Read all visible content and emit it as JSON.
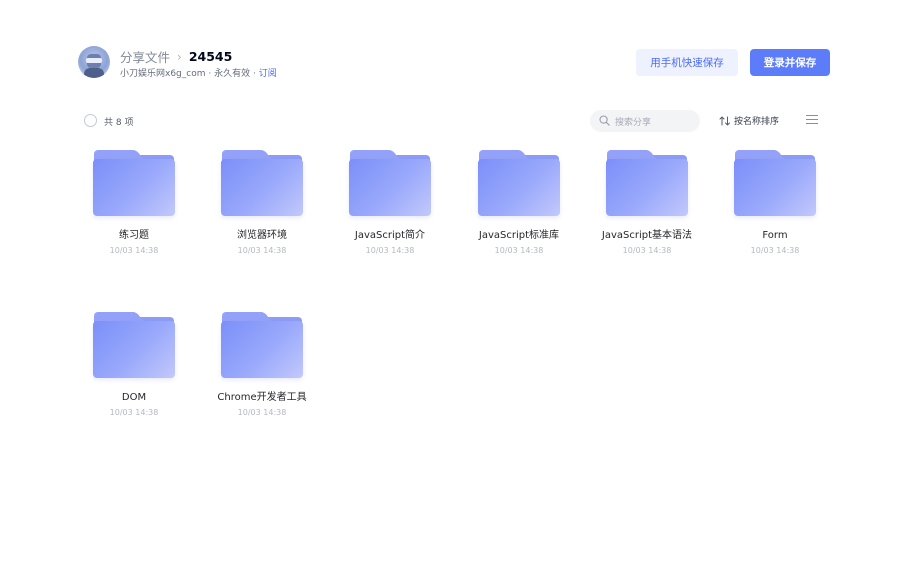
{
  "header": {
    "breadcrumb_root": "分享文件",
    "breadcrumb_sep": "›",
    "breadcrumb_current": "24545",
    "sharer": "小刀娱乐网x6g_com",
    "validity": "永久有效",
    "meta_sep": "·",
    "subscribe_label": "订阅",
    "quick_save_label": "用手机快速保存",
    "login_save_label": "登录并保存"
  },
  "toolbar": {
    "count_label": "共 8 项",
    "search_placeholder": "搜索分享",
    "sort_label": "按名称排序"
  },
  "files": [
    {
      "name": "练习题",
      "date": "10/03 14:38"
    },
    {
      "name": "浏览器环境",
      "date": "10/03 14:38"
    },
    {
      "name": "JavaScript简介",
      "date": "10/03 14:38"
    },
    {
      "name": "JavaScript标准库",
      "date": "10/03 14:38"
    },
    {
      "name": "JavaScript基本语法",
      "date": "10/03 14:38"
    },
    {
      "name": "Form",
      "date": "10/03 14:38"
    },
    {
      "name": "DOM",
      "date": "10/03 14:38"
    },
    {
      "name": "Chrome开发者工具",
      "date": "10/03 14:38"
    }
  ],
  "icons": {
    "avatar": "avatar-icon",
    "folder": "folder-icon",
    "search": "search-icon",
    "sort": "sort-arrows-icon",
    "list_view": "list-view-icon",
    "select_all": "select-all-radio-icon"
  },
  "colors": {
    "primary": "#5c7cfa",
    "primary_light": "#eef1fe",
    "folder": "#8c9cf7",
    "link": "#4d6cf5"
  }
}
